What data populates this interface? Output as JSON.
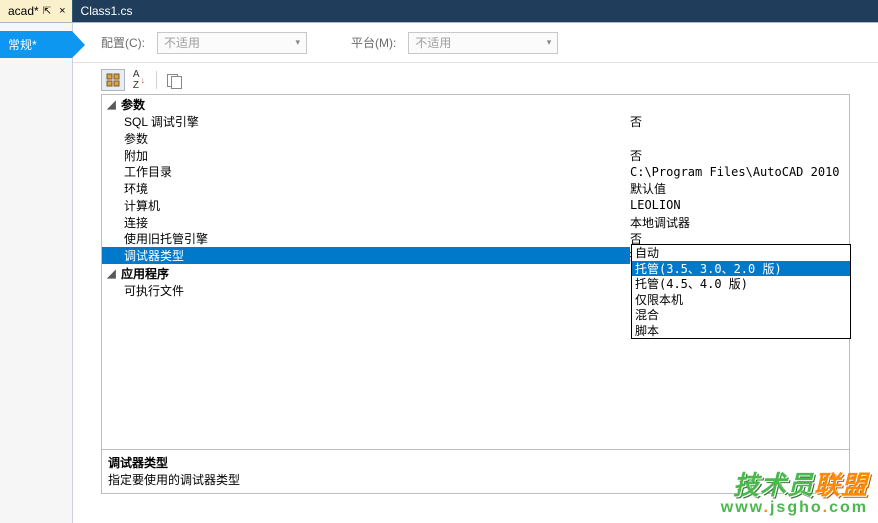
{
  "tabs": [
    {
      "label": "acad*",
      "active": true,
      "close": "×",
      "pin": "⇱"
    },
    {
      "label": "Class1.cs",
      "active": false
    }
  ],
  "sideTab": "常规*",
  "topbar": {
    "configLabel": "配置(C):",
    "configValue": "不适用",
    "platformLabel": "平台(M):",
    "platformValue": "不适用"
  },
  "groups": {
    "g1": {
      "title": "参数",
      "expander": "◢"
    },
    "g2": {
      "title": "应用程序",
      "expander": "◢"
    }
  },
  "rows": {
    "sqlEngine": {
      "name": "SQL 调试引擎",
      "value": "否"
    },
    "params": {
      "name": "参数",
      "value": ""
    },
    "attach": {
      "name": "附加",
      "value": "否"
    },
    "workdir": {
      "name": "工作目录",
      "value": "C:\\Program Files\\AutoCAD 2010"
    },
    "env": {
      "name": "环境",
      "value": "默认值"
    },
    "computer": {
      "name": "计算机",
      "value": "LEOLION"
    },
    "connect": {
      "name": "连接",
      "value": "本地调试器"
    },
    "oldEngine": {
      "name": "使用旧托管引擎",
      "value": "否"
    },
    "debuggerType": {
      "name": "调试器类型",
      "value": "托管(3.5、3.0、2.0 版)"
    },
    "exe": {
      "name": "可执行文件",
      "value": ""
    }
  },
  "combo": {
    "items": [
      "自动",
      "托管(3.5、3.0、2.0 版)",
      "托管(4.5、4.0 版)",
      "仅限本机",
      "混合",
      "脚本"
    ],
    "selectedIndex": 1
  },
  "description": {
    "title": "调试器类型",
    "text": "指定要使用的调试器类型"
  },
  "watermark": {
    "text1": "技术员",
    "text2": "联盟",
    "url_a": "www",
    "url_b": "jsgho",
    "url_c": "com"
  }
}
